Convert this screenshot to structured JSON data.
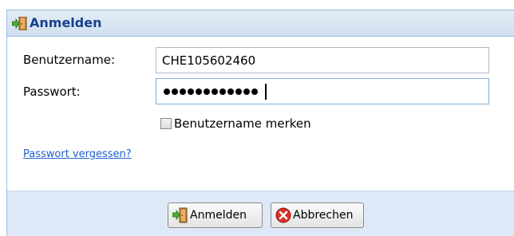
{
  "dialog": {
    "title": "Anmelden",
    "title_icon": "login-door-icon"
  },
  "form": {
    "username_label": "Benutzername:",
    "username_value": "CHE105602460",
    "password_label": "Passwort:",
    "password_masked": "●●●●●●●●●●●●",
    "remember_label": "Benutzername merken",
    "remember_checked": false,
    "forgot_link": "Passwort vergessen?"
  },
  "buttons": {
    "login_label": "Anmelden",
    "login_icon": "login-door-icon",
    "cancel_label": "Abbrechen",
    "cancel_icon": "red-x-icon"
  },
  "colors": {
    "title_text": "#15428b",
    "link": "#1d5ecf",
    "footer_bg": "#dfe8f6",
    "border": "#99bbe8"
  }
}
